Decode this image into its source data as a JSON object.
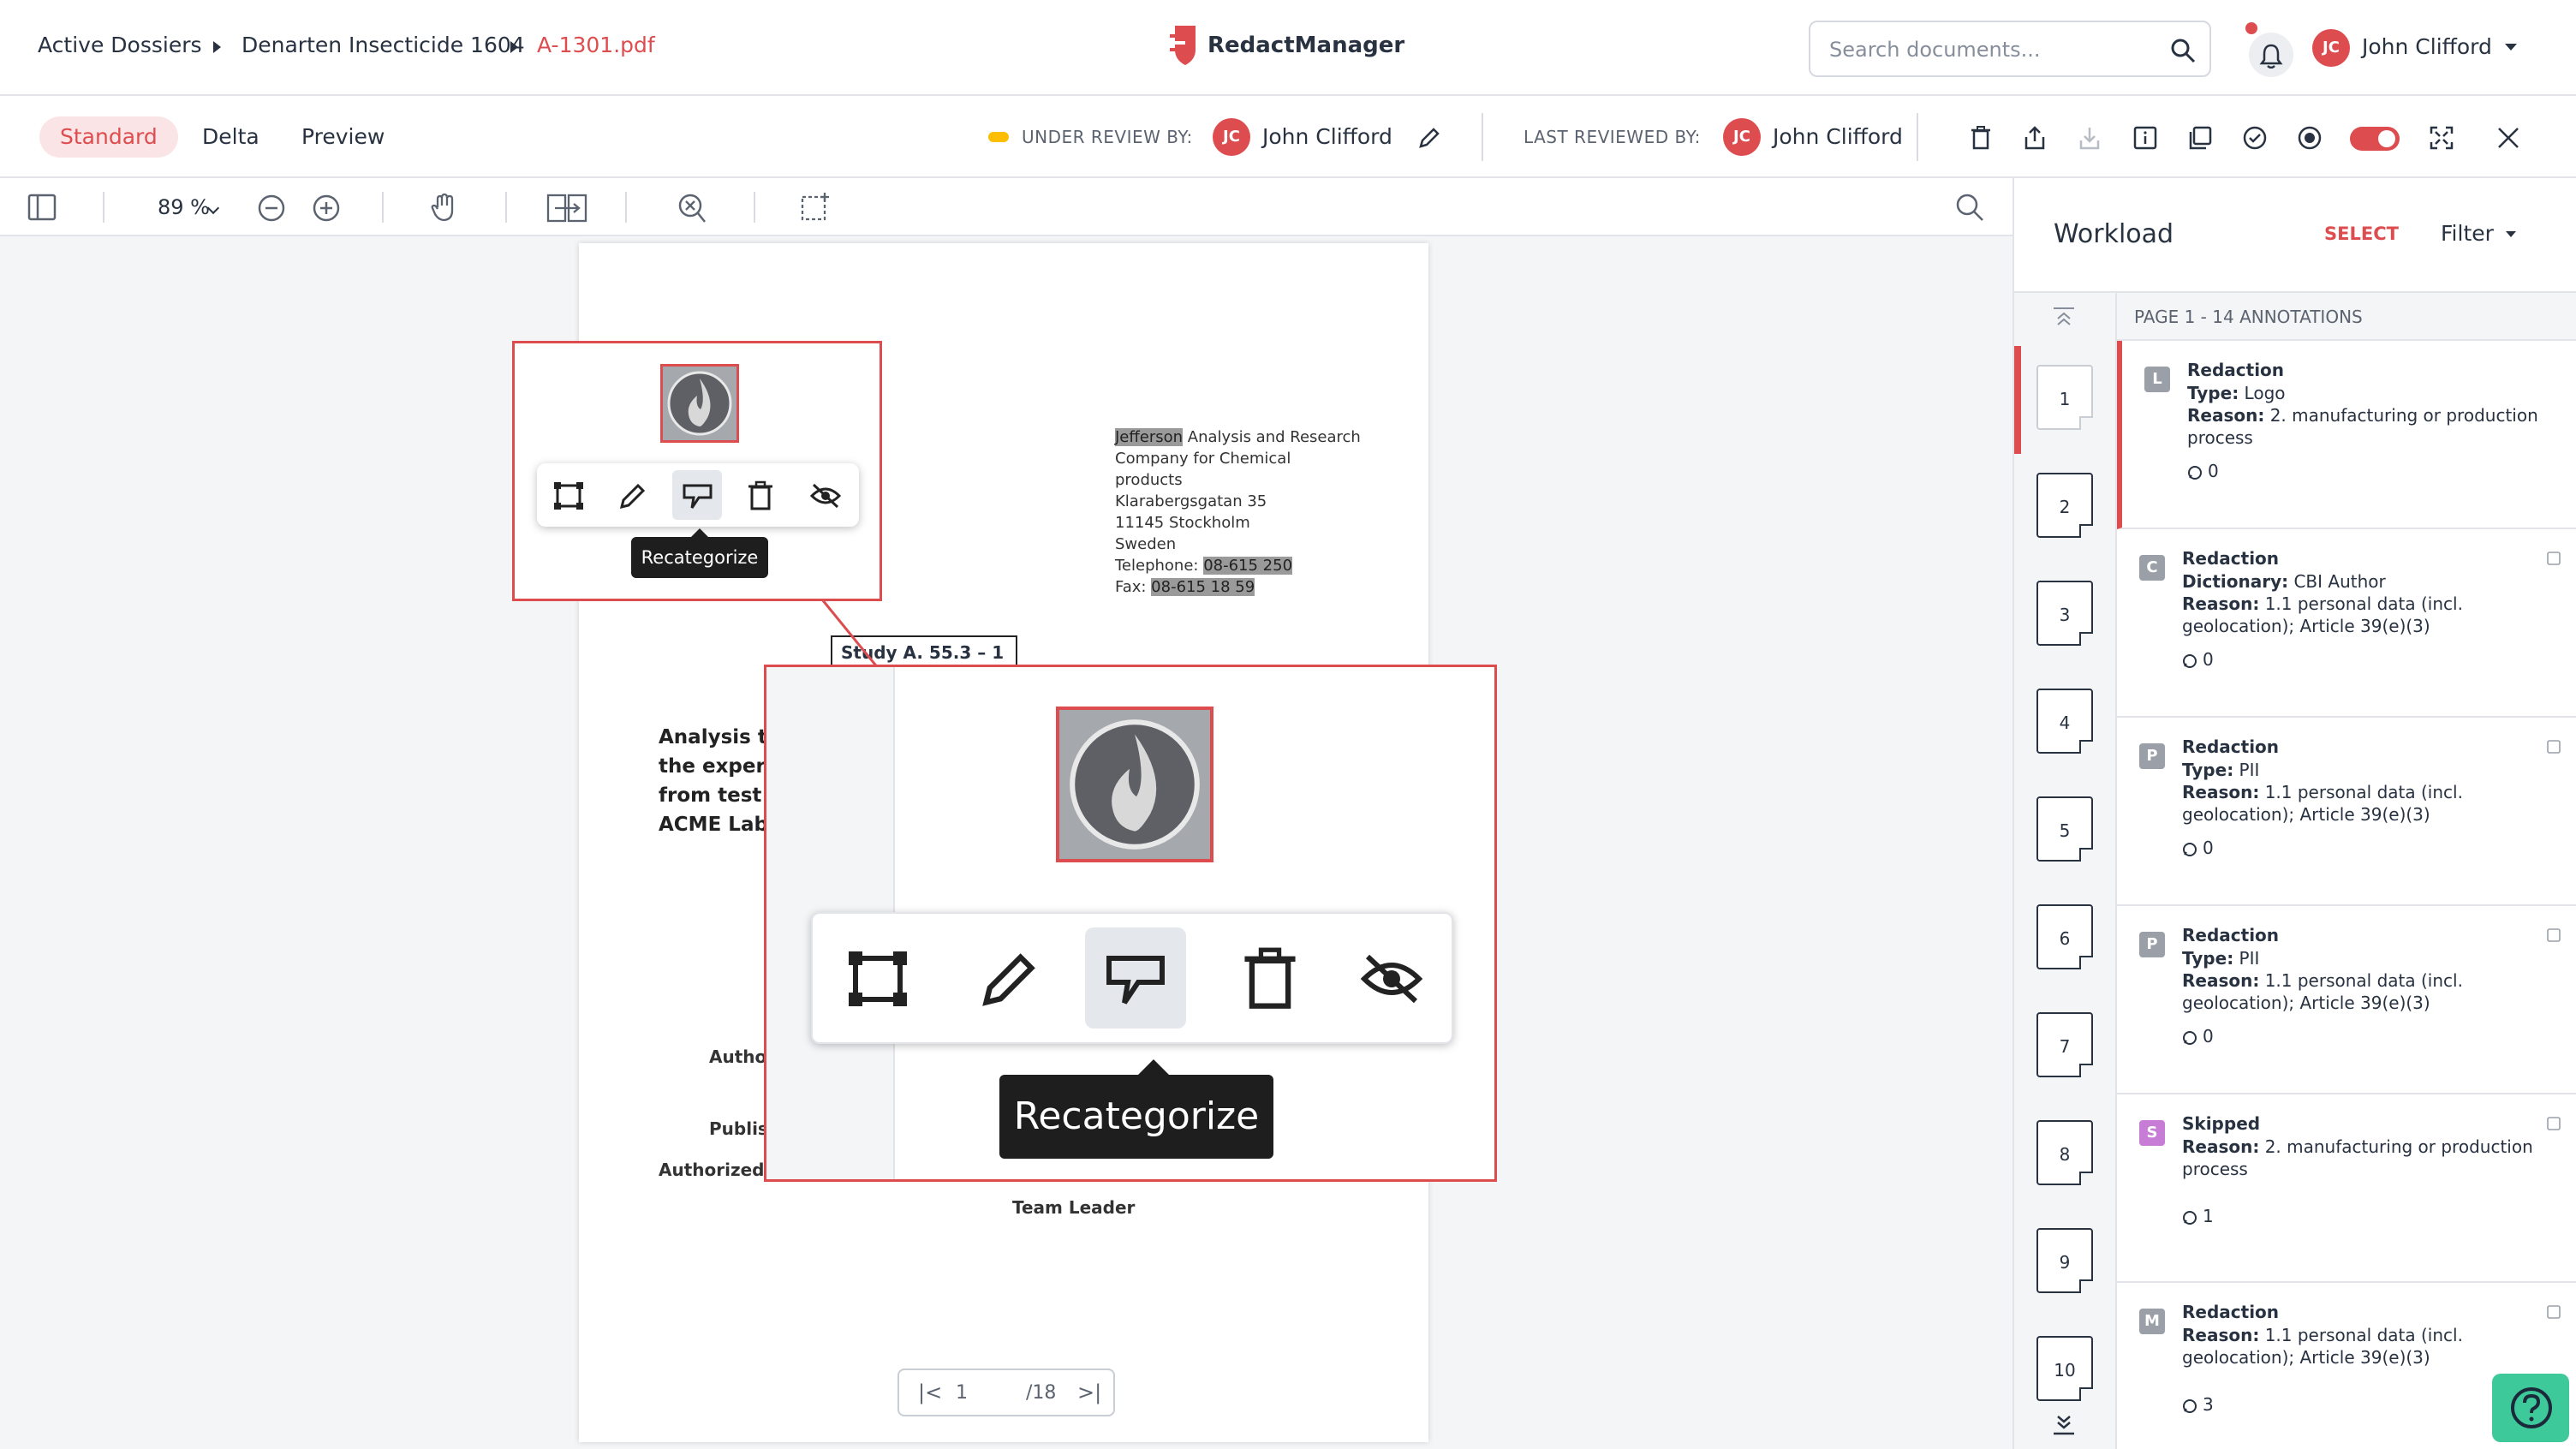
{
  "breadcrumb": {
    "items": [
      "Active Dossiers",
      "Denarten Insecticide 1604",
      "A-1301.pdf"
    ]
  },
  "app": {
    "name": "RedactManager"
  },
  "search": {
    "placeholder": "Search documents..."
  },
  "user": {
    "initials": "JC",
    "name": "John Clifford"
  },
  "tabs": [
    "Standard",
    "Delta",
    "Preview"
  ],
  "review": {
    "under_label": "UNDER REVIEW BY:",
    "under_user": "John Clifford",
    "last_label": "LAST REVIEWED BY:",
    "last_user": "John Clifford"
  },
  "viewer": {
    "zoom": "89 %",
    "page_current": "1",
    "page_total": "/18"
  },
  "document": {
    "address": [
      "Jefferson",
      " Analysis and Research",
      "Company for Chemical",
      "products",
      "Klarabergsgatan 35",
      "11145 Stockholm",
      "Sweden",
      "Telephone: ",
      "08-615 250",
      "Fax: ",
      "08-615 18 59"
    ],
    "study": "Study A. 55.3 – 1",
    "heading_lines": [
      "Analysis to",
      "the experi",
      "from test s",
      "ACME Labs"
    ],
    "author_label": "Autho",
    "publish_label": "Publis",
    "authorized_label": "Authorized b",
    "team_leader": "Team Leader"
  },
  "popup": {
    "tooltip": "Recategorize"
  },
  "panel": {
    "title": "Workload",
    "select": "SELECT",
    "filter": "Filter",
    "page_header": "PAGE 1 - 14 ANNOTATIONS",
    "pages": [
      "1",
      "2",
      "3",
      "4",
      "5",
      "6",
      "7",
      "8",
      "9",
      "10"
    ],
    "annotations": [
      {
        "badge": "L",
        "title": "Redaction",
        "l1k": "Type:",
        "l1v": " Logo",
        "l2k": "Reason:",
        "l2v": " 2. manufacturing or production process",
        "count": "0"
      },
      {
        "badge": "C",
        "title": "Redaction",
        "l1k": "Dictionary:",
        "l1v": " CBI Author",
        "l2k": "Reason:",
        "l2v": " 1.1 personal data (incl. geolocation); Article 39(e)(3)",
        "count": "0"
      },
      {
        "badge": "P",
        "title": "Redaction",
        "l1k": "Type:",
        "l1v": " PII",
        "l2k": "Reason:",
        "l2v": " 1.1 personal data (incl. geolocation); Article 39(e)(3)",
        "count": "0"
      },
      {
        "badge": "P",
        "title": "Redaction",
        "l1k": "Type:",
        "l1v": " PII",
        "l2k": "Reason:",
        "l2v": " 1.1 personal data (incl. geolocation); Article 39(e)(3)",
        "count": "0"
      },
      {
        "badge": "S",
        "title": "Skipped",
        "l1k": "Reason:",
        "l1v": " 2. manufacturing or production process",
        "l2k": "",
        "l2v": "",
        "count": "1"
      },
      {
        "badge": "M",
        "title": "Redaction",
        "l1k": "Reason:",
        "l1v": " 1.1 personal data (incl. geolocation); Article 39(e)(3)",
        "l2k": "",
        "l2v": "",
        "count": "3"
      }
    ]
  },
  "colors": {
    "accent": "#dd4d50",
    "skipped": "#c77dd6",
    "status_dot": "#fdbd00"
  }
}
